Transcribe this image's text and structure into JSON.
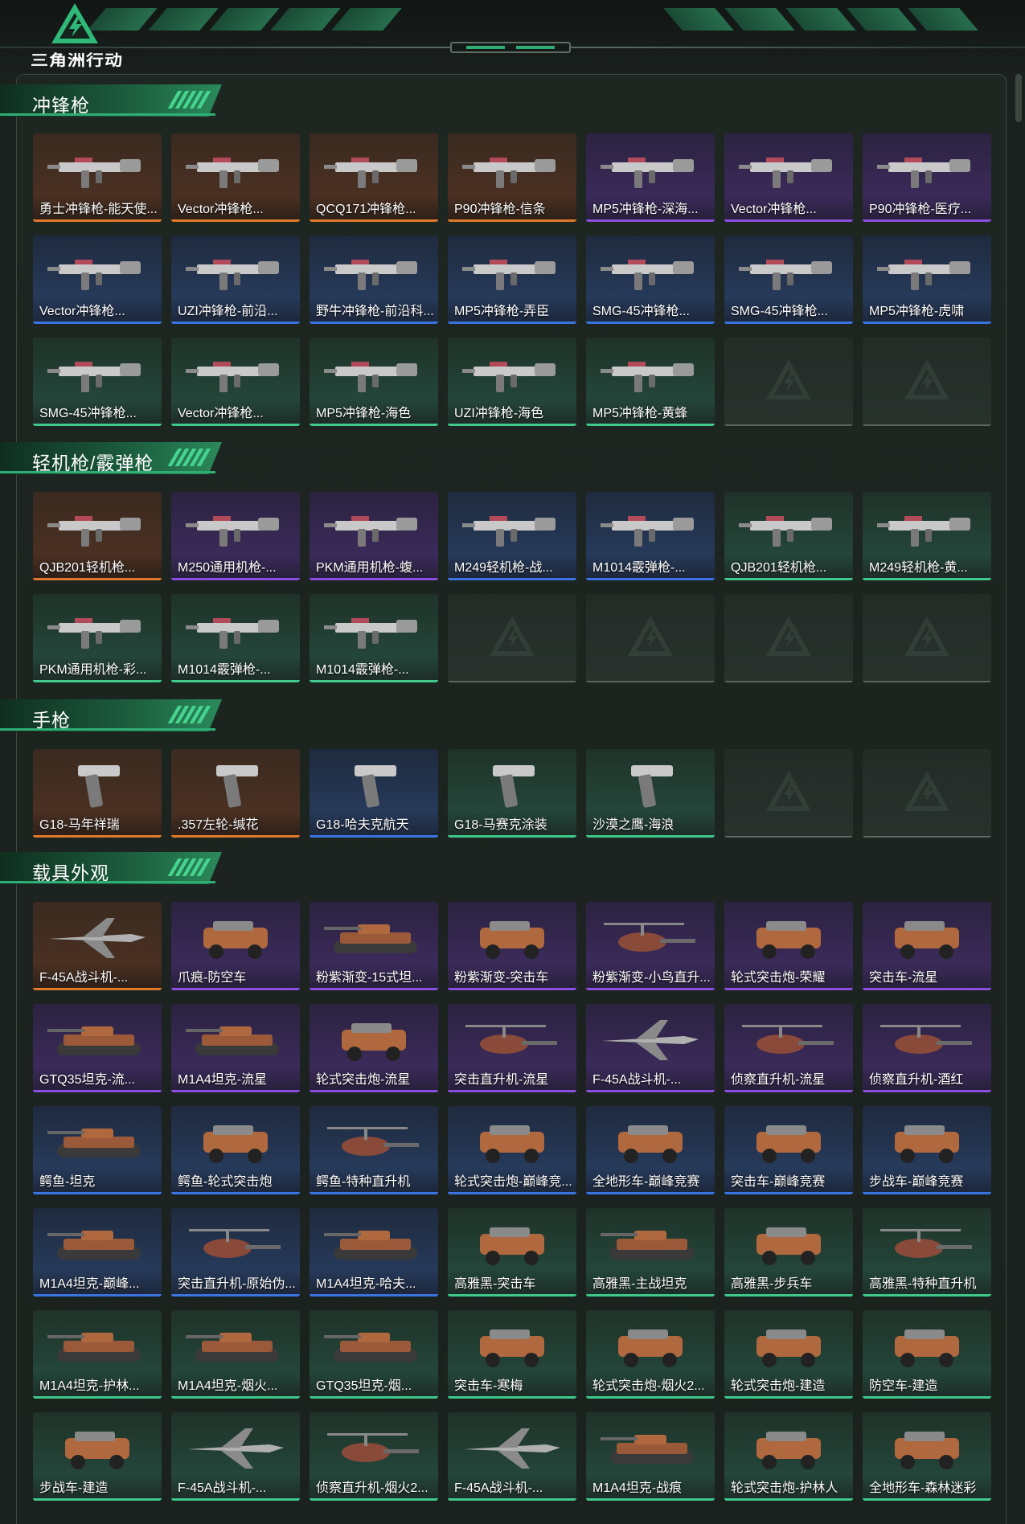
{
  "logo": {
    "text": "三角洲行动"
  },
  "colors": {
    "gold": "#e07a2a",
    "purple": "#8a4fe0",
    "blue": "#3a74e0",
    "green": "#3fc98a"
  },
  "sections": [
    {
      "title": "冲锋枪",
      "items": [
        {
          "label": "勇士冲锋枪-能天使...",
          "rarity": "gold",
          "kind": "gun"
        },
        {
          "label": "Vector冲锋枪...",
          "rarity": "gold",
          "kind": "gun"
        },
        {
          "label": "QCQ171冲锋枪...",
          "rarity": "gold",
          "kind": "gun"
        },
        {
          "label": "P90冲锋枪-信条",
          "rarity": "gold",
          "kind": "gun"
        },
        {
          "label": "MP5冲锋枪-深海...",
          "rarity": "purple",
          "kind": "gun"
        },
        {
          "label": "Vector冲锋枪...",
          "rarity": "purple",
          "kind": "gun"
        },
        {
          "label": "P90冲锋枪-医疗...",
          "rarity": "purple",
          "kind": "gun"
        },
        {
          "label": "Vector冲锋枪...",
          "rarity": "blue",
          "kind": "gun"
        },
        {
          "label": "UZI冲锋枪-前沿...",
          "rarity": "blue",
          "kind": "gun"
        },
        {
          "label": "野牛冲锋枪-前沿科...",
          "rarity": "blue",
          "kind": "gun"
        },
        {
          "label": "MP5冲锋枪-弄臣",
          "rarity": "blue",
          "kind": "gun"
        },
        {
          "label": "SMG-45冲锋枪...",
          "rarity": "blue",
          "kind": "gun"
        },
        {
          "label": "SMG-45冲锋枪...",
          "rarity": "blue",
          "kind": "gun"
        },
        {
          "label": "MP5冲锋枪-虎啸",
          "rarity": "blue",
          "kind": "gun"
        },
        {
          "label": "SMG-45冲锋枪...",
          "rarity": "green",
          "kind": "gun"
        },
        {
          "label": "Vector冲锋枪...",
          "rarity": "green",
          "kind": "gun"
        },
        {
          "label": "MP5冲锋枪-海色",
          "rarity": "green",
          "kind": "gun"
        },
        {
          "label": "UZI冲锋枪-海色",
          "rarity": "green",
          "kind": "gun"
        },
        {
          "label": "MP5冲锋枪-黄蜂",
          "rarity": "green",
          "kind": "gun"
        },
        {
          "label": "",
          "rarity": "empty",
          "kind": "empty"
        },
        {
          "label": "",
          "rarity": "empty",
          "kind": "empty"
        }
      ]
    },
    {
      "title": "轻机枪/霰弹枪",
      "items": [
        {
          "label": "QJB201轻机枪...",
          "rarity": "gold",
          "kind": "gun"
        },
        {
          "label": "M250通用机枪-...",
          "rarity": "purple",
          "kind": "gun"
        },
        {
          "label": "PKM通用机枪-蝮...",
          "rarity": "purple",
          "kind": "gun"
        },
        {
          "label": "M249轻机枪-战...",
          "rarity": "blue",
          "kind": "gun"
        },
        {
          "label": "M1014霰弹枪-...",
          "rarity": "blue",
          "kind": "gun"
        },
        {
          "label": "QJB201轻机枪...",
          "rarity": "green",
          "kind": "gun"
        },
        {
          "label": "M249轻机枪-黄...",
          "rarity": "green",
          "kind": "gun"
        },
        {
          "label": "PKM通用机枪-彩...",
          "rarity": "green",
          "kind": "gun"
        },
        {
          "label": "M1014霰弹枪-...",
          "rarity": "green",
          "kind": "gun"
        },
        {
          "label": "M1014霰弹枪-...",
          "rarity": "green",
          "kind": "gun"
        },
        {
          "label": "",
          "rarity": "empty",
          "kind": "empty"
        },
        {
          "label": "",
          "rarity": "empty",
          "kind": "empty"
        },
        {
          "label": "",
          "rarity": "empty",
          "kind": "empty"
        },
        {
          "label": "",
          "rarity": "empty",
          "kind": "empty"
        }
      ]
    },
    {
      "title": "手枪",
      "items": [
        {
          "label": "G18-马年祥瑞",
          "rarity": "gold",
          "kind": "pistol"
        },
        {
          "label": ".357左轮-缄花",
          "rarity": "gold",
          "kind": "pistol"
        },
        {
          "label": "G18-哈夫克航天",
          "rarity": "blue",
          "kind": "pistol"
        },
        {
          "label": "G18-马赛克涂装",
          "rarity": "green",
          "kind": "pistol"
        },
        {
          "label": "沙漠之鹰-海浪",
          "rarity": "green",
          "kind": "pistol"
        },
        {
          "label": "",
          "rarity": "empty",
          "kind": "empty"
        },
        {
          "label": "",
          "rarity": "empty",
          "kind": "empty"
        }
      ]
    },
    {
      "title": "载具外观",
      "items": [
        {
          "label": "F-45A战斗机-...",
          "rarity": "gold",
          "kind": "jet"
        },
        {
          "label": "爪痕-防空车",
          "rarity": "purple",
          "kind": "car"
        },
        {
          "label": "粉紫渐变-15式坦...",
          "rarity": "purple",
          "kind": "tank"
        },
        {
          "label": "粉紫渐变-突击车",
          "rarity": "purple",
          "kind": "car"
        },
        {
          "label": "粉紫渐变-小鸟直升...",
          "rarity": "purple",
          "kind": "heli"
        },
        {
          "label": "轮式突击炮-荣耀",
          "rarity": "purple",
          "kind": "car"
        },
        {
          "label": "突击车-流星",
          "rarity": "purple",
          "kind": "car"
        },
        {
          "label": "GTQ35坦克-流...",
          "rarity": "purple",
          "kind": "tank"
        },
        {
          "label": "M1A4坦克-流星",
          "rarity": "purple",
          "kind": "tank"
        },
        {
          "label": "轮式突击炮-流星",
          "rarity": "purple",
          "kind": "car"
        },
        {
          "label": "突击直升机-流星",
          "rarity": "purple",
          "kind": "heli"
        },
        {
          "label": "F-45A战斗机-...",
          "rarity": "purple",
          "kind": "jet"
        },
        {
          "label": "侦察直升机-流星",
          "rarity": "purple",
          "kind": "heli"
        },
        {
          "label": "侦察直升机-酒红",
          "rarity": "purple",
          "kind": "heli"
        },
        {
          "label": "鳄鱼-坦克",
          "rarity": "blue",
          "kind": "tank"
        },
        {
          "label": "鳄鱼-轮式突击炮",
          "rarity": "blue",
          "kind": "car"
        },
        {
          "label": "鳄鱼-特种直升机",
          "rarity": "blue",
          "kind": "heli"
        },
        {
          "label": "轮式突击炮-巅峰竞...",
          "rarity": "blue",
          "kind": "car"
        },
        {
          "label": "全地形车-巅峰竞赛",
          "rarity": "blue",
          "kind": "car"
        },
        {
          "label": "突击车-巅峰竞赛",
          "rarity": "blue",
          "kind": "car"
        },
        {
          "label": "步战车-巅峰竞赛",
          "rarity": "blue",
          "kind": "car"
        },
        {
          "label": "M1A4坦克-巅峰...",
          "rarity": "blue",
          "kind": "tank"
        },
        {
          "label": "突击直升机-原始伪...",
          "rarity": "blue",
          "kind": "heli"
        },
        {
          "label": "M1A4坦克-哈夫...",
          "rarity": "blue",
          "kind": "tank"
        },
        {
          "label": "高雅黑-突击车",
          "rarity": "green",
          "kind": "car"
        },
        {
          "label": "高雅黑-主战坦克",
          "rarity": "green",
          "kind": "tank"
        },
        {
          "label": "高雅黑-步兵车",
          "rarity": "green",
          "kind": "car"
        },
        {
          "label": "高雅黑-特种直升机",
          "rarity": "green",
          "kind": "heli"
        },
        {
          "label": "M1A4坦克-护林...",
          "rarity": "green",
          "kind": "tank"
        },
        {
          "label": "M1A4坦克-烟火...",
          "rarity": "green",
          "kind": "tank"
        },
        {
          "label": "GTQ35坦克-烟...",
          "rarity": "green",
          "kind": "tank"
        },
        {
          "label": "突击车-寒梅",
          "rarity": "green",
          "kind": "car"
        },
        {
          "label": "轮式突击炮-烟火2...",
          "rarity": "green",
          "kind": "car"
        },
        {
          "label": "轮式突击炮-建造",
          "rarity": "green",
          "kind": "car"
        },
        {
          "label": "防空车-建造",
          "rarity": "green",
          "kind": "car"
        },
        {
          "label": "步战车-建造",
          "rarity": "green",
          "kind": "car"
        },
        {
          "label": "F-45A战斗机-...",
          "rarity": "green",
          "kind": "jet"
        },
        {
          "label": "侦察直升机-烟火2...",
          "rarity": "green",
          "kind": "heli"
        },
        {
          "label": "F-45A战斗机-...",
          "rarity": "green",
          "kind": "jet"
        },
        {
          "label": "M1A4坦克-战痕",
          "rarity": "green",
          "kind": "tank"
        },
        {
          "label": "轮式突击炮-护林人",
          "rarity": "green",
          "kind": "car"
        },
        {
          "label": "全地形车-森林迷彩",
          "rarity": "green",
          "kind": "car"
        }
      ]
    }
  ]
}
